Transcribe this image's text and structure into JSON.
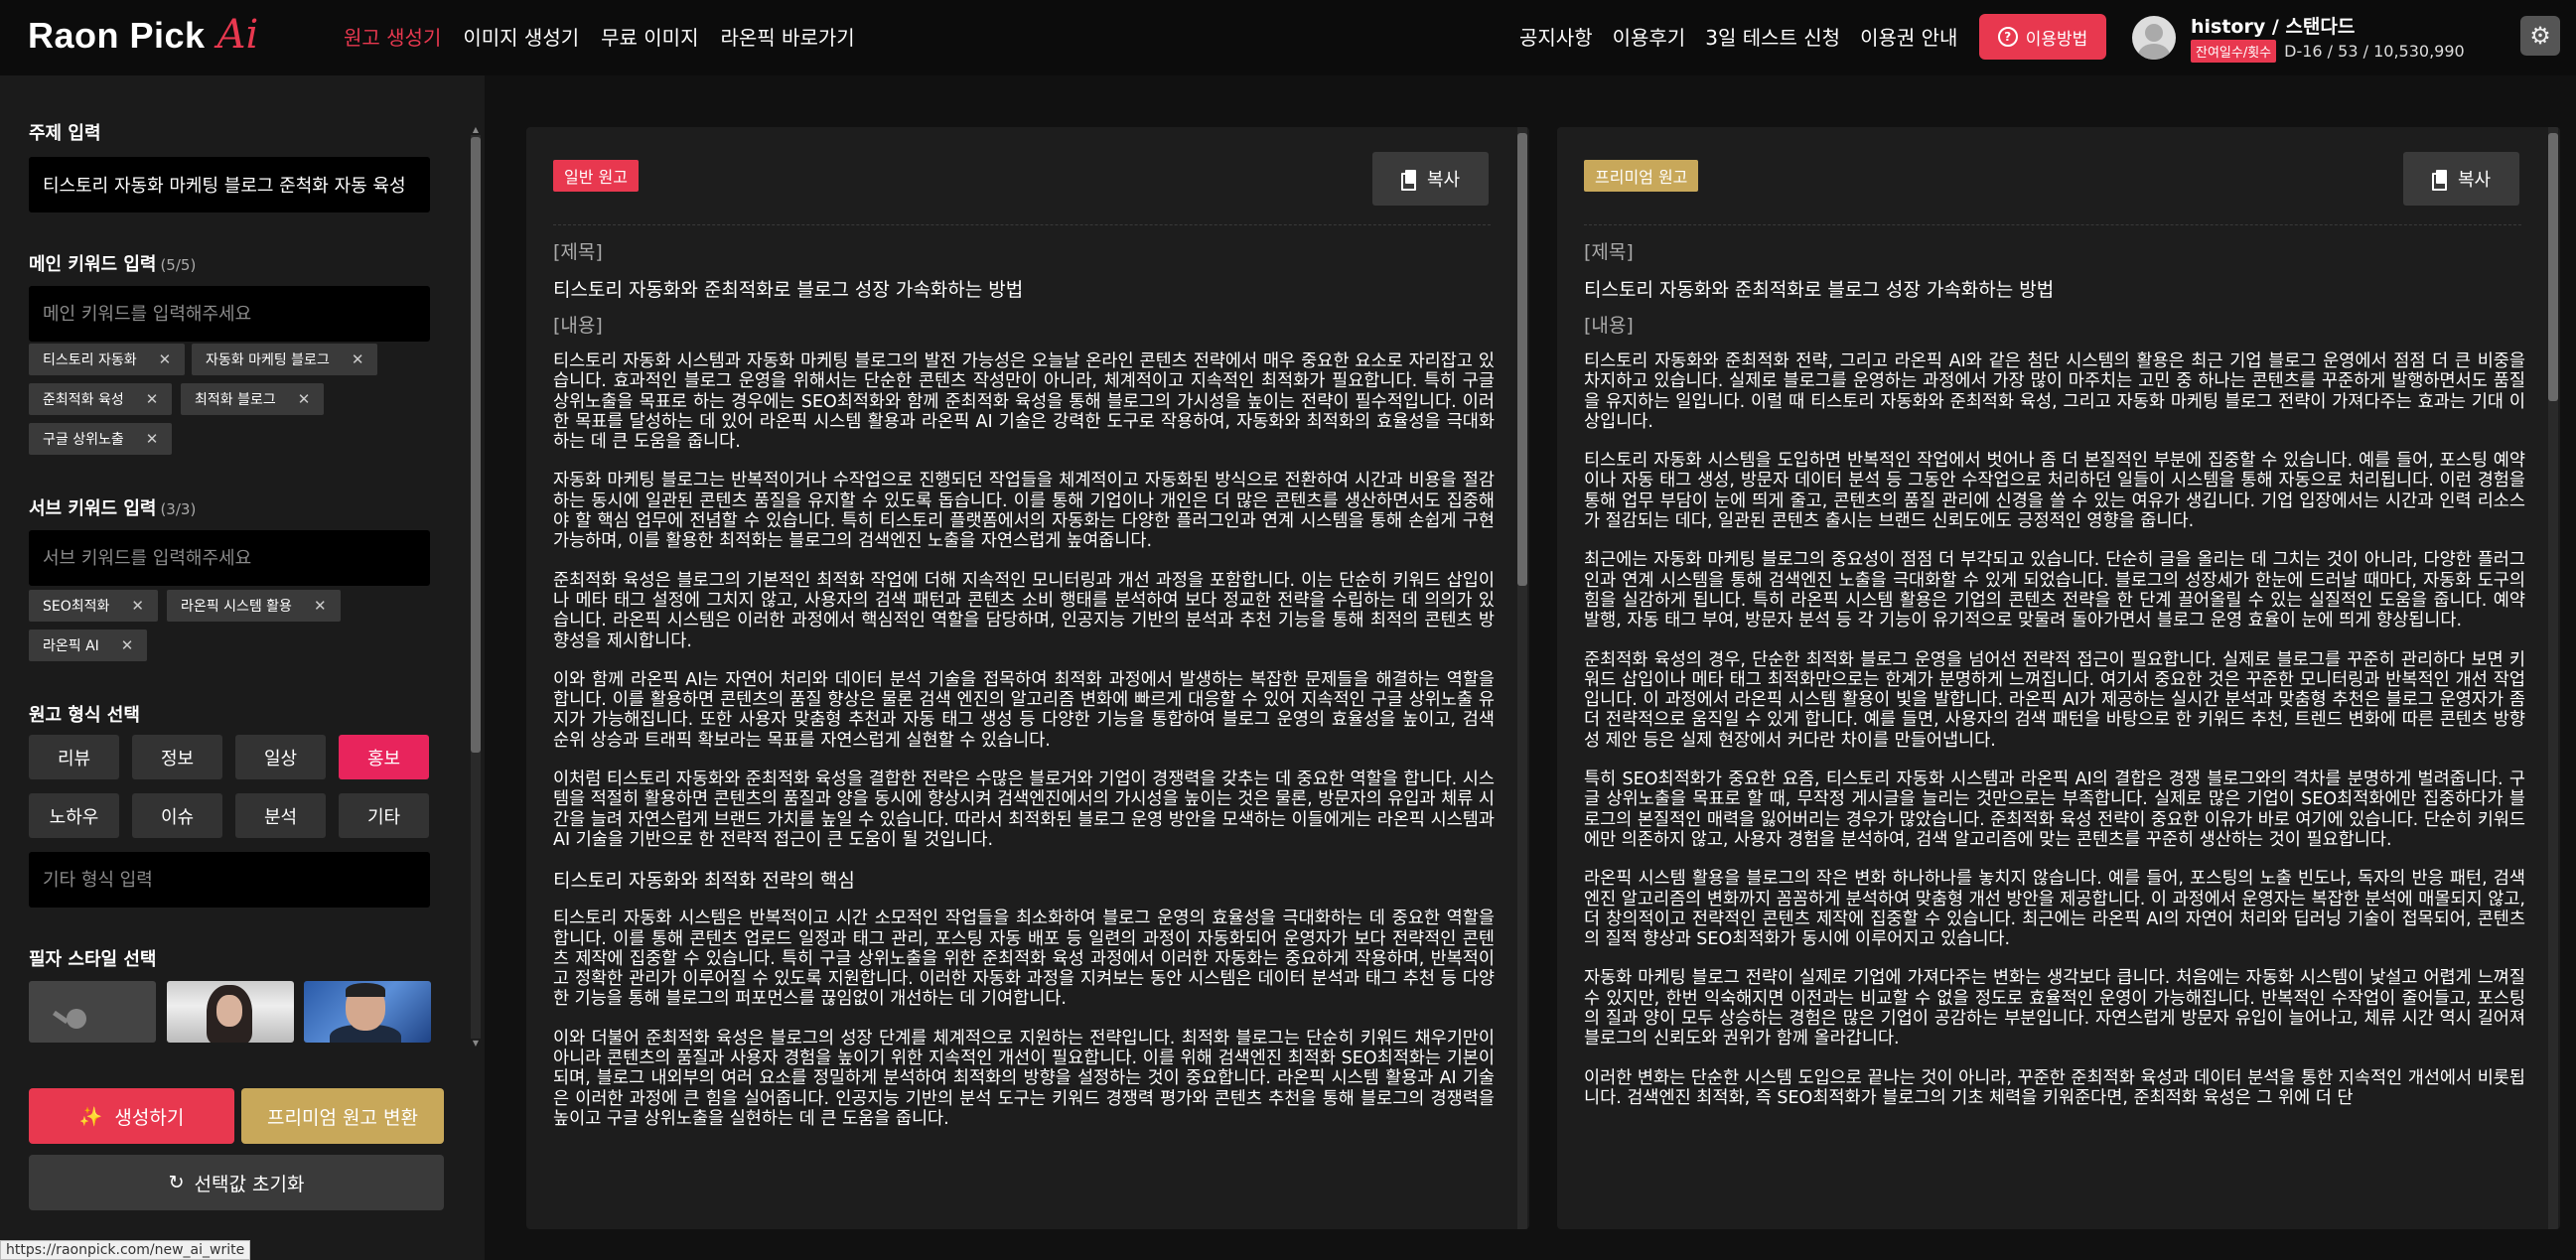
{
  "header": {
    "logo_text": "Raon Pick",
    "logo_ai": "Ai",
    "nav_left": [
      "원고 생성기",
      "이미지 생성기",
      "무료 이미지",
      "라온픽 바로가기"
    ],
    "nav_right": [
      "공지사항",
      "이용후기",
      "3일 테스트 신청",
      "이용권 안내"
    ],
    "help_label": "이용방법",
    "user_name": "history / 스탠다드",
    "user_badge": "잔여일수/횟수",
    "user_stats": "D-16 / 53 / 10,530,990"
  },
  "sidebar": {
    "topic_label": "주제 입력",
    "topic_value": "티스토리 자동화 마케팅 블로그 준척화 자동 육성",
    "main_kw_label": "메인 키워드 입력",
    "main_kw_count": "(5/5)",
    "main_kw_placeholder": "메인 키워드를 입력해주세요",
    "main_keywords": [
      "티스토리 자동화",
      "자동화 마케팅 블로그",
      "준최적화 육성",
      "최적화 블로그",
      "구글 상위노출"
    ],
    "sub_kw_label": "서브 키워드 입력",
    "sub_kw_count": "(3/3)",
    "sub_kw_placeholder": "서브 키워드를 입력해주세요",
    "sub_keywords": [
      "SEO최적화",
      "라온픽 시스템 활용",
      "라온픽 AI"
    ],
    "format_label": "원고 형식 선택",
    "formats": [
      "리뷰",
      "정보",
      "일상",
      "홍보",
      "노하우",
      "이슈",
      "분석",
      "기타"
    ],
    "format_active": "홍보",
    "format_other_placeholder": "기타 형식 입력",
    "style_label": "필자 스타일 선택",
    "generate_label": "생성하기",
    "premium_label": "프리미엄 원고 변환",
    "reset_label": "선택값 초기화",
    "status_url": "https://raonpick.com/new_ai_write"
  },
  "panel_general": {
    "badge": "일반 원고",
    "copy_label": "복사",
    "title_tag": "[제목]",
    "title": "티스토리 자동화와 준최적화로 블로그 성장 가속화하는 방법",
    "body_tag": "[내용]",
    "paragraphs": [
      "티스토리 자동화 시스템과 자동화 마케팅 블로그의 발전 가능성은 오늘날 온라인 콘텐츠 전략에서 매우 중요한 요소로 자리잡고 있습니다. 효과적인 블로그 운영을 위해서는 단순한 콘텐츠 작성만이 아니라, 체계적이고 지속적인 최적화가 필요합니다. 특히 구글 상위노출을 목표로 하는 경우에는 SEO최적화와 함께 준최적화 육성을 통해 블로그의 가시성을 높이는 전략이 필수적입니다. 이러한 목표를 달성하는 데 있어 라온픽 시스템 활용과 라온픽 AI 기술은 강력한 도구로 작용하여, 자동화와 최적화의 효율성을 극대화하는 데 큰 도움을 줍니다.",
      "자동화 마케팅 블로그는 반복적이거나 수작업으로 진행되던 작업들을 체계적이고 자동화된 방식으로 전환하여 시간과 비용을 절감하는 동시에 일관된 콘텐츠 품질을 유지할 수 있도록 돕습니다. 이를 통해 기업이나 개인은 더 많은 콘텐츠를 생산하면서도 집중해야 할 핵심 업무에 전념할 수 있습니다. 특히 티스토리 플랫폼에서의 자동화는 다양한 플러그인과 연계 시스템을 통해 손쉽게 구현 가능하며, 이를 활용한 최적화는 블로그의 검색엔진 노출을 자연스럽게 높여줍니다.",
      "준최적화 육성은 블로그의 기본적인 최적화 작업에 더해 지속적인 모니터링과 개선 과정을 포함합니다. 이는 단순히 키워드 삽입이나 메타 태그 설정에 그치지 않고, 사용자의 검색 패턴과 콘텐츠 소비 행태를 분석하여 보다 정교한 전략을 수립하는 데 의의가 있습니다. 라온픽 시스템은 이러한 과정에서 핵심적인 역할을 담당하며, 인공지능 기반의 분석과 추천 기능을 통해 최적의 콘텐츠 방향성을 제시합니다.",
      "이와 함께 라온픽 AI는 자연어 처리와 데이터 분석 기술을 접목하여 최적화 과정에서 발생하는 복잡한 문제들을 해결하는 역할을 합니다. 이를 활용하면 콘텐츠의 품질 향상은 물론 검색 엔진의 알고리즘 변화에 빠르게 대응할 수 있어 지속적인 구글 상위노출 유지가 가능해집니다. 또한 사용자 맞춤형 추천과 자동 태그 생성 등 다양한 기능을 통합하여 블로그 운영의 효율성을 높이고, 검색 순위 상승과 트래픽 확보라는 목표를 자연스럽게 실현할 수 있습니다.",
      "이처럼 티스토리 자동화와 준최적화 육성을 결합한 전략은 수많은 블로거와 기업이 경쟁력을 갖추는 데 중요한 역할을 합니다. 시스템을 적절히 활용하면 콘텐츠의 품질과 양을 동시에 향상시켜 검색엔진에서의 가시성을 높이는 것은 물론, 방문자의 유입과 체류 시간을 늘려 자연스럽게 브랜드 가치를 높일 수 있습니다. 따라서 최적화된 블로그 운영 방안을 모색하는 이들에게는 라온픽 시스템과 AI 기술을 기반으로 한 전략적 접근이 큰 도움이 될 것입니다."
    ],
    "subhead": "티스토리 자동화와 최적화 전략의 핵심",
    "paragraphs2": [
      "티스토리 자동화 시스템은 반복적이고 시간 소모적인 작업들을 최소화하여 블로그 운영의 효율성을 극대화하는 데 중요한 역할을 합니다. 이를 통해 콘텐츠 업로드 일정과 태그 관리, 포스팅 자동 배포 등 일련의 과정이 자동화되어 운영자가 보다 전략적인 콘텐츠 제작에 집중할 수 있습니다. 특히 구글 상위노출을 위한 준최적화 육성 과정에서 이러한 자동화는 중요하게 작용하며, 반복적이고 정확한 관리가 이루어질 수 있도록 지원합니다. 이러한 자동화 과정을 지켜보는 동안 시스템은 데이터 분석과 태그 추천 등 다양한 기능을 통해 블로그의 퍼포먼스를 끊임없이 개선하는 데 기여합니다.",
      "이와 더불어 준최적화 육성은 블로그의 성장 단계를 체계적으로 지원하는 전략입니다. 최적화 블로그는 단순히 키워드 채우기만이 아니라 콘텐츠의 품질과 사용자 경험을 높이기 위한 지속적인 개선이 필요합니다. 이를 위해 검색엔진 최적화 SEO최적화는 기본이 되며, 블로그 내외부의 여러 요소를 정밀하게 분석하여 최적화의 방향을 설정하는 것이 중요합니다. 라온픽 시스템 활용과 AI 기술은 이러한 과정에 큰 힘을 실어줍니다. 인공지능 기반의 분석 도구는 키워드 경쟁력 평가와 콘텐츠 추천을 통해 블로그의 경쟁력을 높이고 구글 상위노출을 실현하는 데 큰 도움을 줍니다."
    ]
  },
  "panel_premium": {
    "badge": "프리미엄 원고",
    "copy_label": "복사",
    "title_tag": "[제목]",
    "title": "티스토리 자동화와 준최적화로 블로그 성장 가속화하는 방법",
    "body_tag": "[내용]",
    "paragraphs": [
      "티스토리 자동화와 준최적화 전략, 그리고 라온픽 AI와 같은 첨단 시스템의 활용은 최근 기업 블로그 운영에서 점점 더 큰 비중을 차지하고 있습니다. 실제로 블로그를 운영하는 과정에서 가장 많이 마주치는 고민 중 하나는 콘텐츠를 꾸준하게 발행하면서도 품질을 유지하는 일입니다. 이럴 때 티스토리 자동화와 준최적화 육성, 그리고 자동화 마케팅 블로그 전략이 가져다주는 효과는 기대 이상입니다.",
      "티스토리 자동화 시스템을 도입하면 반복적인 작업에서 벗어나 좀 더 본질적인 부분에 집중할 수 있습니다. 예를 들어, 포스팅 예약이나 자동 태그 생성, 방문자 데이터 분석 등 그동안 수작업으로 처리하던 일들이 시스템을 통해 자동으로 처리됩니다. 이런 경험을 통해 업무 부담이 눈에 띄게 줄고, 콘텐츠의 품질 관리에 신경을 쓸 수 있는 여유가 생깁니다. 기업 입장에서는 시간과 인력 리소스가 절감되는 데다, 일관된 콘텐츠 출시는 브랜드 신뢰도에도 긍정적인 영향을 줍니다.",
      "최근에는 자동화 마케팅 블로그의 중요성이 점점 더 부각되고 있습니다. 단순히 글을 올리는 데 그치는 것이 아니라, 다양한 플러그인과 연계 시스템을 통해 검색엔진 노출을 극대화할 수 있게 되었습니다. 블로그의 성장세가 한눈에 드러날 때마다, 자동화 도구의 힘을 실감하게 됩니다. 특히 라온픽 시스템 활용은 기업의 콘텐츠 전략을 한 단계 끌어올릴 수 있는 실질적인 도움을 줍니다. 예약 발행, 자동 태그 부여, 방문자 분석 등 각 기능이 유기적으로 맞물려 돌아가면서 블로그 운영 효율이 눈에 띄게 향상됩니다.",
      "준최적화 육성의 경우, 단순한 최적화 블로그 운영을 넘어선 전략적 접근이 필요합니다. 실제로 블로그를 꾸준히 관리하다 보면 키워드 삽입이나 메타 태그 최적화만으로는 한계가 분명하게 느껴집니다. 여기서 중요한 것은 꾸준한 모니터링과 반복적인 개선 작업입니다. 이 과정에서 라온픽 시스템 활용이 빛을 발합니다. 라온픽 AI가 제공하는 실시간 분석과 맞춤형 추천은 블로그 운영자가 좀 더 전략적으로 움직일 수 있게 합니다. 예를 들면, 사용자의 검색 패턴을 바탕으로 한 키워드 추천, 트렌드 변화에 따른 콘텐츠 방향성 제안 등은 실제 현장에서 커다란 차이를 만들어냅니다.",
      "특히 SEO최적화가 중요한 요즘, 티스토리 자동화 시스템과 라온픽 AI의 결합은 경쟁 블로그와의 격차를 분명하게 벌려줍니다. 구글 상위노출을 목표로 할 때, 무작정 게시글을 늘리는 것만으로는 부족합니다. 실제로 많은 기업이 SEO최적화에만 집중하다가 블로그의 본질적인 매력을 잃어버리는 경우가 많았습니다. 준최적화 육성 전략이 중요한 이유가 바로 여기에 있습니다. 단순히 키워드에만 의존하지 않고, 사용자 경험을 분석하여, 검색 알고리즘에 맞는 콘텐츠를 꾸준히 생산하는 것이 필요합니다.",
      "라온픽 시스템 활용을 블로그의 작은 변화 하나하나를 놓치지 않습니다. 예를 들어, 포스팅의 노출 빈도나, 독자의 반응 패턴, 검색엔진 알고리즘의 변화까지 꼼꼼하게 분석하여 맞춤형 개선 방안을 제공합니다. 이 과정에서 운영자는 복잡한 분석에 매몰되지 않고, 더 창의적이고 전략적인 콘텐츠 제작에 집중할 수 있습니다. 최근에는 라온픽 AI의 자연어 처리와 딥러닝 기술이 접목되어, 콘텐츠의 질적 향상과 SEO최적화가 동시에 이루어지고 있습니다.",
      "자동화 마케팅 블로그 전략이 실제로 기업에 가져다주는 변화는 생각보다 큽니다. 처음에는 자동화 시스템이 낯설고 어렵게 느껴질 수 있지만, 한번 익숙해지면 이전과는 비교할 수 없을 정도로 효율적인 운영이 가능해집니다. 반복적인 수작업이 줄어들고, 포스팅의 질과 양이 모두 상승하는 경험은 많은 기업이 공감하는 부분입니다. 자연스럽게 방문자 유입이 늘어나고, 체류 시간 역시 길어져 블로그의 신뢰도와 권위가 함께 올라갑니다.",
      "이러한 변화는 단순한 시스템 도입으로 끝나는 것이 아니라, 꾸준한 준최적화 육성과 데이터 분석을 통한 지속적인 개선에서 비롯됩니다. 검색엔진 최적화, 즉 SEO최적화가 블로그의 기초 체력을 키워준다면, 준최적화 육성은 그 위에 더 단"
    ]
  }
}
